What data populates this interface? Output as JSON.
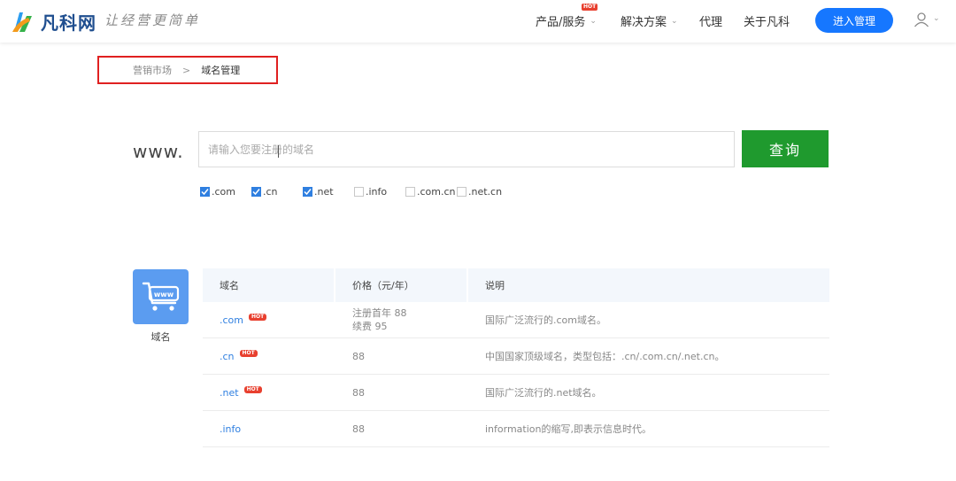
{
  "header": {
    "logo_text": "凡科网",
    "slogan": "让经营更简单",
    "nav": [
      {
        "label": "产品/服务",
        "badge": "HOT",
        "has_dropdown": true
      },
      {
        "label": "解决方案",
        "has_dropdown": true
      },
      {
        "label": "代理",
        "has_dropdown": false
      },
      {
        "label": "关于凡科",
        "has_dropdown": false
      }
    ],
    "login_button": "进入管理"
  },
  "breadcrumb": {
    "parent": "营销市场",
    "separator": ">",
    "current": "域名管理"
  },
  "search": {
    "prefix": "www.",
    "placeholder": "请输入您要注册的域名",
    "button": "查询",
    "options": [
      {
        "label": ".com",
        "checked": true
      },
      {
        "label": ".cn",
        "checked": true
      },
      {
        "label": ".net",
        "checked": true
      },
      {
        "label": ".info",
        "checked": false
      },
      {
        "label": ".com.cn",
        "checked": false
      },
      {
        "label": ".net.cn",
        "checked": false
      }
    ]
  },
  "category": {
    "icon": "www-cart-icon",
    "icon_text": "www",
    "label": "域名"
  },
  "table": {
    "headers": [
      "域名",
      "价格（元/年）",
      "说明"
    ],
    "rows": [
      {
        "domain": ".com",
        "hot": "HOT",
        "price": [
          "注册首年 88",
          "续费 95"
        ],
        "desc": "国际广泛流行的.com域名。"
      },
      {
        "domain": ".cn",
        "hot": "HOT",
        "price": [
          "88"
        ],
        "desc": "中国国家顶级域名，类型包括：.cn/.com.cn/.net.cn。"
      },
      {
        "domain": ".net",
        "hot": "HOT",
        "price": [
          "88"
        ],
        "desc": "国际广泛流行的.net域名。"
      },
      {
        "domain": ".info",
        "hot": null,
        "price": [
          "88"
        ],
        "desc": "information的缩写,即表示信息时代。"
      }
    ]
  },
  "colors": {
    "primary": "#1677ff",
    "search_button": "#1f9a2e",
    "hot_badge": "#e8402f",
    "highlight_box": "#e02020",
    "link": "#2f7fe0"
  }
}
